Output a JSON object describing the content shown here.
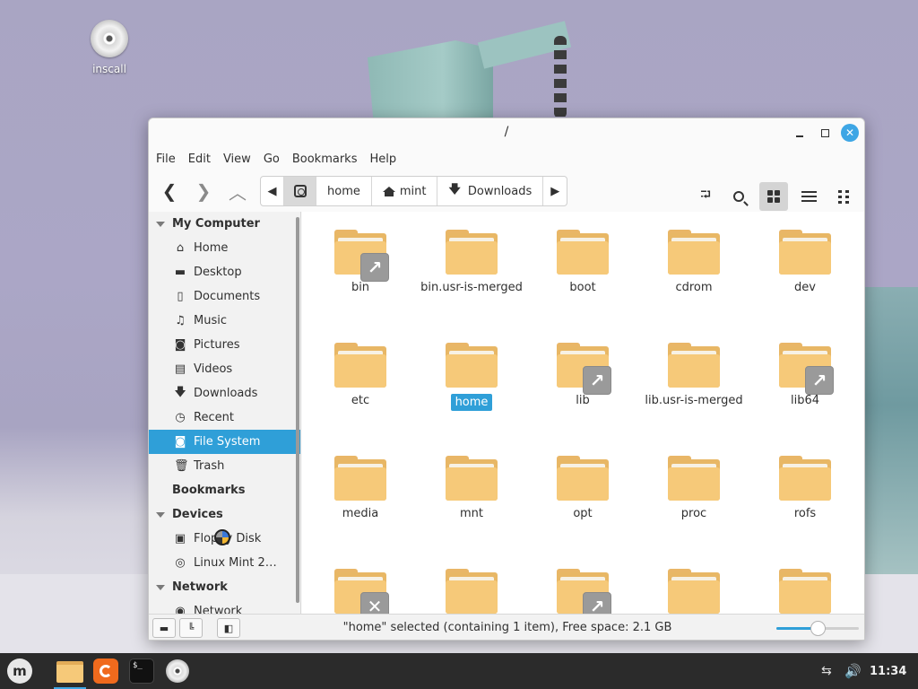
{
  "desktop": {
    "icons": [
      {
        "label": "inscall",
        "icon": "disc-icon"
      }
    ]
  },
  "window": {
    "title": "/",
    "menu": [
      "File",
      "Edit",
      "View",
      "Go",
      "Bookmarks",
      "Help"
    ],
    "pathbar": [
      {
        "label": "home",
        "icon": "none"
      },
      {
        "label": "mint",
        "icon": "home-icon"
      },
      {
        "label": "Downloads",
        "icon": "download-icon"
      }
    ],
    "sidebar": {
      "my_computer": {
        "title": "My Computer",
        "items": [
          {
            "label": "Home",
            "icon": "home-icon"
          },
          {
            "label": "Desktop",
            "icon": "desktop-icon"
          },
          {
            "label": "Documents",
            "icon": "document-icon"
          },
          {
            "label": "Music",
            "icon": "music-icon"
          },
          {
            "label": "Pictures",
            "icon": "camera-icon"
          },
          {
            "label": "Videos",
            "icon": "film-icon"
          },
          {
            "label": "Downloads",
            "icon": "download-icon"
          },
          {
            "label": "Recent",
            "icon": "clock-icon"
          },
          {
            "label": "File System",
            "icon": "drive-icon",
            "selected": true
          },
          {
            "label": "Trash",
            "icon": "trash-icon"
          }
        ]
      },
      "bookmarks": {
        "title": "Bookmarks"
      },
      "devices": {
        "title": "Devices",
        "items": [
          {
            "label": "Floppy Disk",
            "icon": "floppy-icon"
          },
          {
            "label": "Linux Mint 2…",
            "icon": "disc-icon"
          }
        ]
      },
      "network": {
        "title": "Network",
        "items": [
          {
            "label": "Network",
            "icon": "network-icon"
          }
        ]
      }
    },
    "files": [
      {
        "name": "bin",
        "emblem": "symlink"
      },
      {
        "name": "bin.usr-is-merged"
      },
      {
        "name": "boot"
      },
      {
        "name": "cdrom"
      },
      {
        "name": "dev"
      },
      {
        "name": "etc"
      },
      {
        "name": "home",
        "selected": true
      },
      {
        "name": "lib",
        "emblem": "symlink"
      },
      {
        "name": "lib.usr-is-merged"
      },
      {
        "name": "lib64",
        "emblem": "symlink"
      },
      {
        "name": "media"
      },
      {
        "name": "mnt"
      },
      {
        "name": "opt"
      },
      {
        "name": "proc"
      },
      {
        "name": "rofs"
      },
      {
        "name": "",
        "emblem": "unreadable"
      },
      {
        "name": ""
      },
      {
        "name": "",
        "emblem": "symlink"
      },
      {
        "name": ""
      },
      {
        "name": ""
      }
    ],
    "status": {
      "text": "\"home\" selected (containing 1 item), Free space: 2.1 GB",
      "zoom_level": 0.5
    }
  },
  "taskbar": {
    "apps": [
      "menu-icon",
      "files-icon",
      "firefox-icon",
      "terminal-icon",
      "disc-icon"
    ],
    "terminal_prompt": "$_",
    "clock": "11:34"
  },
  "colors": {
    "accent": "#2f9fd8",
    "folder": "#f6c979",
    "taskbar": "#2b2b2b"
  }
}
